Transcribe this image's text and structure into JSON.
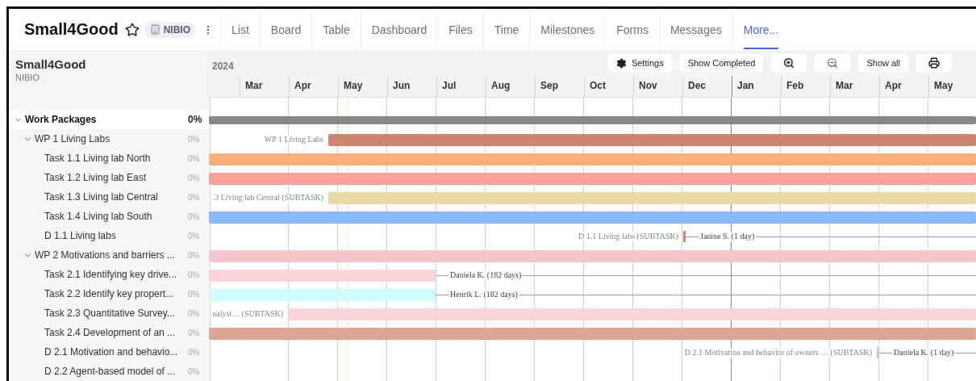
{
  "header": {
    "title": "Small4Good",
    "starred": false,
    "workspace": "NIBIO"
  },
  "tabs": [
    {
      "label": "List",
      "selected": false
    },
    {
      "label": "Board",
      "selected": false
    },
    {
      "label": "Table",
      "selected": false
    },
    {
      "label": "Dashboard",
      "selected": false
    },
    {
      "label": "Files",
      "selected": false
    },
    {
      "label": "Time",
      "selected": false
    },
    {
      "label": "Milestones",
      "selected": false
    },
    {
      "label": "Forms",
      "selected": false
    },
    {
      "label": "Messages",
      "selected": false
    },
    {
      "label": "More...",
      "selected": true
    }
  ],
  "sidebar": {
    "title": "Small4Good",
    "subtitle": "NIBIO"
  },
  "toolbar": [
    {
      "kind": "settings",
      "label": "Settings"
    },
    {
      "kind": "text",
      "label": "Show Completed"
    },
    {
      "kind": "zoom-in"
    },
    {
      "kind": "zoom-out"
    },
    {
      "kind": "text",
      "label": "Show all"
    },
    {
      "kind": "print"
    }
  ],
  "timeline": {
    "year": "2024",
    "months": [
      "Mar",
      "Apr",
      "May",
      "Jun",
      "Jul",
      "Aug",
      "Sep",
      "Oct",
      "Nov",
      "Dec",
      "Jan",
      "Feb",
      "Mar",
      "Apr",
      "May"
    ]
  },
  "tree": [
    {
      "label": "Work Packages",
      "progress": "0%",
      "expanded": true,
      "bar": {
        "kind": "summary",
        "color": "#888888"
      },
      "children": [
        {
          "label": "WP 1 Living Labs",
          "progress": "0%",
          "expanded": true,
          "bar": {
            "kind": "bar",
            "color": "#cd8770",
            "label_before": "WP 1 Living Labs"
          },
          "children": [
            {
              "label": "Task 1.1 Living lab North",
              "progress": "0%",
              "bar": {
                "kind": "bar",
                "color": "#ffad7a"
              }
            },
            {
              "label": "Task 1.2 Living lab East",
              "progress": "0%",
              "bar": {
                "kind": "bar",
                "color": "#f9a19a"
              }
            },
            {
              "label": "Task 1.3 Living lab Central",
              "progress": "0%",
              "bar": {
                "kind": "bar",
                "color": "#e8d9a6",
                "label_before": ".3 Living lab Central (SUBTASK)"
              }
            },
            {
              "label": "Task 1.4 Living lab South",
              "progress": "0%",
              "bar": {
                "kind": "bar",
                "color": "#8ab8ff"
              }
            },
            {
              "label": "D 1.1 Living labs",
              "progress": "0%",
              "bar": {
                "kind": "milestone",
                "color": "#cd8770",
                "label_before": "D 1.1 Living labs (SUBTASK)",
                "label_after": "Janine S. (1 day)"
              }
            }
          ]
        },
        {
          "label": "WP 2 Motivations and barriers ...",
          "progress": "0%",
          "expanded": true,
          "bar": {
            "kind": "bar",
            "color": "#f4c5cc"
          },
          "children": [
            {
              "label": "Task 2.1 Identifying key drive...",
              "progress": "0%",
              "bar": {
                "kind": "bar",
                "color": "#f8d3da",
                "label_after": "Daniela K. (182 days)"
              }
            },
            {
              "label": "Task 2.2 Identify key propert...",
              "progress": "0%",
              "bar": {
                "kind": "bar",
                "color": "#d1fbfb",
                "label_after": "Henrik L. (182 days)"
              }
            },
            {
              "label": "Task 2.3 Quantitative Survey...",
              "progress": "0%",
              "bar": {
                "kind": "bar",
                "color": "#f8d3da",
                "label_before": "nalysi… (SUBTASK)"
              }
            },
            {
              "label": "Task 2.4 Development of an ...",
              "progress": "0%",
              "bar": {
                "kind": "bar",
                "color": "#dca895"
              }
            },
            {
              "label": "D 2.1 Motivation and behavio...",
              "progress": "0%",
              "bar": {
                "kind": "milestone",
                "color": "#f4b8c4",
                "label_before": "D 2.1 Motivation and behavior of owners … (SUBTASK)",
                "label_after": "Daniela K. (1 day)"
              }
            },
            {
              "label": "D 2.2 Agent-based model of ...",
              "progress": "0%"
            }
          ]
        }
      ]
    }
  ]
}
